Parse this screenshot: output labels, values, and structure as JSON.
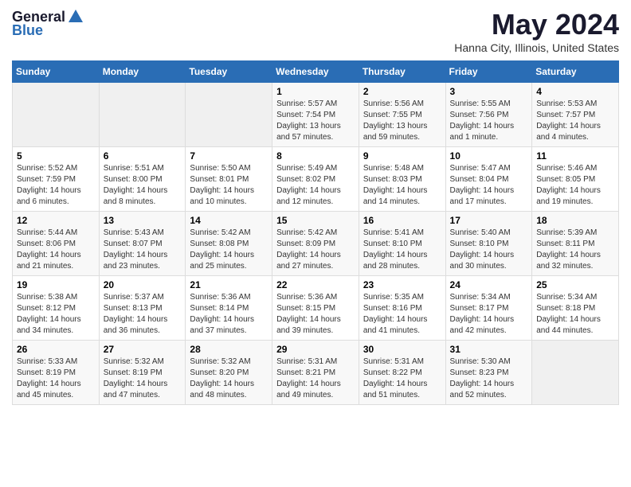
{
  "header": {
    "logo_general": "General",
    "logo_blue": "Blue",
    "month_title": "May 2024",
    "location": "Hanna City, Illinois, United States"
  },
  "weekdays": [
    "Sunday",
    "Monday",
    "Tuesday",
    "Wednesday",
    "Thursday",
    "Friday",
    "Saturday"
  ],
  "weeks": [
    [
      {
        "day": "",
        "empty": true
      },
      {
        "day": "",
        "empty": true
      },
      {
        "day": "",
        "empty": true
      },
      {
        "day": "1",
        "sunrise": "Sunrise: 5:57 AM",
        "sunset": "Sunset: 7:54 PM",
        "daylight": "Daylight: 13 hours and 57 minutes."
      },
      {
        "day": "2",
        "sunrise": "Sunrise: 5:56 AM",
        "sunset": "Sunset: 7:55 PM",
        "daylight": "Daylight: 13 hours and 59 minutes."
      },
      {
        "day": "3",
        "sunrise": "Sunrise: 5:55 AM",
        "sunset": "Sunset: 7:56 PM",
        "daylight": "Daylight: 14 hours and 1 minute."
      },
      {
        "day": "4",
        "sunrise": "Sunrise: 5:53 AM",
        "sunset": "Sunset: 7:57 PM",
        "daylight": "Daylight: 14 hours and 4 minutes."
      }
    ],
    [
      {
        "day": "5",
        "sunrise": "Sunrise: 5:52 AM",
        "sunset": "Sunset: 7:59 PM",
        "daylight": "Daylight: 14 hours and 6 minutes."
      },
      {
        "day": "6",
        "sunrise": "Sunrise: 5:51 AM",
        "sunset": "Sunset: 8:00 PM",
        "daylight": "Daylight: 14 hours and 8 minutes."
      },
      {
        "day": "7",
        "sunrise": "Sunrise: 5:50 AM",
        "sunset": "Sunset: 8:01 PM",
        "daylight": "Daylight: 14 hours and 10 minutes."
      },
      {
        "day": "8",
        "sunrise": "Sunrise: 5:49 AM",
        "sunset": "Sunset: 8:02 PM",
        "daylight": "Daylight: 14 hours and 12 minutes."
      },
      {
        "day": "9",
        "sunrise": "Sunrise: 5:48 AM",
        "sunset": "Sunset: 8:03 PM",
        "daylight": "Daylight: 14 hours and 14 minutes."
      },
      {
        "day": "10",
        "sunrise": "Sunrise: 5:47 AM",
        "sunset": "Sunset: 8:04 PM",
        "daylight": "Daylight: 14 hours and 17 minutes."
      },
      {
        "day": "11",
        "sunrise": "Sunrise: 5:46 AM",
        "sunset": "Sunset: 8:05 PM",
        "daylight": "Daylight: 14 hours and 19 minutes."
      }
    ],
    [
      {
        "day": "12",
        "sunrise": "Sunrise: 5:44 AM",
        "sunset": "Sunset: 8:06 PM",
        "daylight": "Daylight: 14 hours and 21 minutes."
      },
      {
        "day": "13",
        "sunrise": "Sunrise: 5:43 AM",
        "sunset": "Sunset: 8:07 PM",
        "daylight": "Daylight: 14 hours and 23 minutes."
      },
      {
        "day": "14",
        "sunrise": "Sunrise: 5:42 AM",
        "sunset": "Sunset: 8:08 PM",
        "daylight": "Daylight: 14 hours and 25 minutes."
      },
      {
        "day": "15",
        "sunrise": "Sunrise: 5:42 AM",
        "sunset": "Sunset: 8:09 PM",
        "daylight": "Daylight: 14 hours and 27 minutes."
      },
      {
        "day": "16",
        "sunrise": "Sunrise: 5:41 AM",
        "sunset": "Sunset: 8:10 PM",
        "daylight": "Daylight: 14 hours and 28 minutes."
      },
      {
        "day": "17",
        "sunrise": "Sunrise: 5:40 AM",
        "sunset": "Sunset: 8:10 PM",
        "daylight": "Daylight: 14 hours and 30 minutes."
      },
      {
        "day": "18",
        "sunrise": "Sunrise: 5:39 AM",
        "sunset": "Sunset: 8:11 PM",
        "daylight": "Daylight: 14 hours and 32 minutes."
      }
    ],
    [
      {
        "day": "19",
        "sunrise": "Sunrise: 5:38 AM",
        "sunset": "Sunset: 8:12 PM",
        "daylight": "Daylight: 14 hours and 34 minutes."
      },
      {
        "day": "20",
        "sunrise": "Sunrise: 5:37 AM",
        "sunset": "Sunset: 8:13 PM",
        "daylight": "Daylight: 14 hours and 36 minutes."
      },
      {
        "day": "21",
        "sunrise": "Sunrise: 5:36 AM",
        "sunset": "Sunset: 8:14 PM",
        "daylight": "Daylight: 14 hours and 37 minutes."
      },
      {
        "day": "22",
        "sunrise": "Sunrise: 5:36 AM",
        "sunset": "Sunset: 8:15 PM",
        "daylight": "Daylight: 14 hours and 39 minutes."
      },
      {
        "day": "23",
        "sunrise": "Sunrise: 5:35 AM",
        "sunset": "Sunset: 8:16 PM",
        "daylight": "Daylight: 14 hours and 41 minutes."
      },
      {
        "day": "24",
        "sunrise": "Sunrise: 5:34 AM",
        "sunset": "Sunset: 8:17 PM",
        "daylight": "Daylight: 14 hours and 42 minutes."
      },
      {
        "day": "25",
        "sunrise": "Sunrise: 5:34 AM",
        "sunset": "Sunset: 8:18 PM",
        "daylight": "Daylight: 14 hours and 44 minutes."
      }
    ],
    [
      {
        "day": "26",
        "sunrise": "Sunrise: 5:33 AM",
        "sunset": "Sunset: 8:19 PM",
        "daylight": "Daylight: 14 hours and 45 minutes."
      },
      {
        "day": "27",
        "sunrise": "Sunrise: 5:32 AM",
        "sunset": "Sunset: 8:19 PM",
        "daylight": "Daylight: 14 hours and 47 minutes."
      },
      {
        "day": "28",
        "sunrise": "Sunrise: 5:32 AM",
        "sunset": "Sunset: 8:20 PM",
        "daylight": "Daylight: 14 hours and 48 minutes."
      },
      {
        "day": "29",
        "sunrise": "Sunrise: 5:31 AM",
        "sunset": "Sunset: 8:21 PM",
        "daylight": "Daylight: 14 hours and 49 minutes."
      },
      {
        "day": "30",
        "sunrise": "Sunrise: 5:31 AM",
        "sunset": "Sunset: 8:22 PM",
        "daylight": "Daylight: 14 hours and 51 minutes."
      },
      {
        "day": "31",
        "sunrise": "Sunrise: 5:30 AM",
        "sunset": "Sunset: 8:23 PM",
        "daylight": "Daylight: 14 hours and 52 minutes."
      },
      {
        "day": "",
        "empty": true
      }
    ]
  ]
}
